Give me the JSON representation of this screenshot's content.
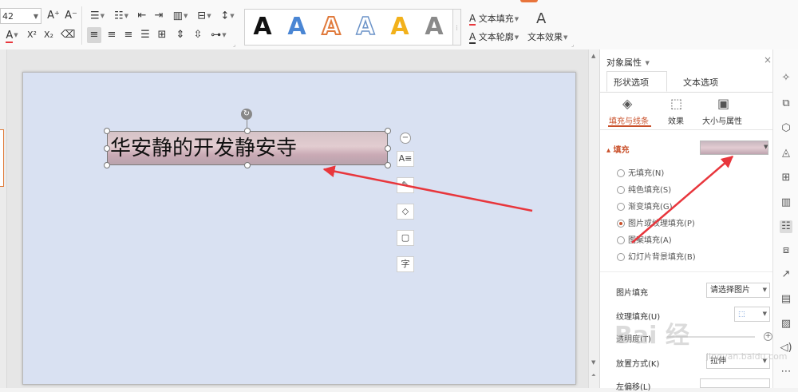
{
  "ribbon": {
    "font_size": "42",
    "grow_font": "A⁺",
    "shrink_font": "A⁻",
    "font_color_label": "A",
    "superscript": "X²",
    "subscript": "X₂",
    "wordart_styles": [
      "A",
      "A",
      "A",
      "A",
      "A",
      "A"
    ],
    "text_fill_label": "文本填充",
    "text_outline_label": "文本轮廓",
    "text_effect_label": "文本效果",
    "text_effect_glyph": "A"
  },
  "slide": {
    "textbox_text": "华安静的开发静安寺",
    "rotate_glyph": "↻",
    "collapse_glyph": "−",
    "float_tools": [
      "A≡",
      "✎",
      "◇",
      "▢",
      "字"
    ]
  },
  "panel": {
    "title": "对象属性",
    "close": "×",
    "tabs": [
      "形状选项",
      "文本选项"
    ],
    "subtabs": [
      {
        "label": "填充与线条",
        "icon": "paint-bucket-icon"
      },
      {
        "label": "效果",
        "icon": "effects-icon"
      },
      {
        "label": "大小与属性",
        "icon": "size-icon"
      }
    ],
    "fill_section": "▴ 填充",
    "fill_options": [
      "无填充(N)",
      "纯色填充(S)",
      "渐变填充(G)",
      "图片或纹理填充(P)",
      "图案填充(A)",
      "幻灯片背景填充(B)"
    ],
    "selected_fill_index": 3,
    "picture_fill_label": "图片填充",
    "picture_fill_value": "请选择图片",
    "texture_fill_label": "纹理填充(U)",
    "transparency_label": "透明度(T)",
    "placement_label": "放置方式(K)",
    "placement_value": "拉伸",
    "offset_label": "左偏移(L)"
  },
  "rail_icons": [
    "pin-icon",
    "shape-style-icon",
    "layers-icon",
    "fill-icon",
    "grid-icon",
    "chart-icon",
    "properties-icon",
    "transform-icon",
    "share-icon",
    "archive-icon",
    "image-icon",
    "audio-icon",
    "more-icon"
  ],
  "watermark": {
    "text": "Bai 经",
    "sub": "jingyan.baidu.com"
  },
  "colors": {
    "accent": "#c9502a",
    "arrow": "#e8363c",
    "slide_bg": "#d9e1f2"
  }
}
